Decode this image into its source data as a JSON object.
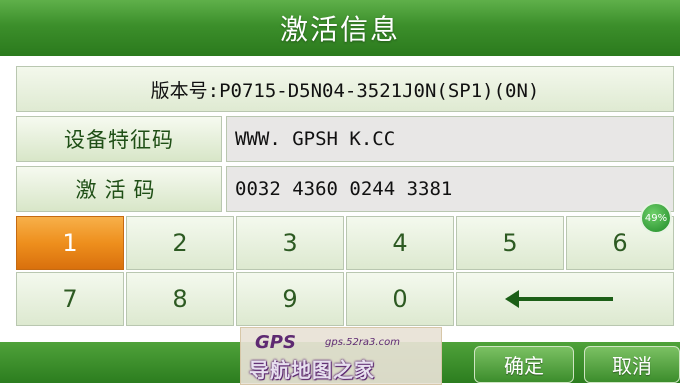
{
  "header": {
    "title": "激活信息"
  },
  "info": {
    "version": "版本号:P0715-D5N04-3521J0N(SP1)(0N)",
    "device_label": "设备特征码",
    "device_value": "WWW. GPSH K.CC",
    "activation_label": "激活码",
    "activation_value": "0032 4360 0244 3381"
  },
  "keypad": {
    "row1": [
      "1",
      "2",
      "3",
      "4",
      "5",
      "6"
    ],
    "row2": [
      "7",
      "8",
      "9",
      "0"
    ],
    "active_key": "1",
    "backspace_icon": "left-arrow-icon"
  },
  "footer": {
    "confirm": "确定",
    "cancel": "取消"
  },
  "overlay": {
    "badge": "49%"
  },
  "watermark": {
    "logo": "GPS",
    "url": "gps.52ra3.com",
    "name": "导航地图之家"
  },
  "colors": {
    "accent_green": "#3c8f2b",
    "active_orange": "#ee8f1d"
  }
}
